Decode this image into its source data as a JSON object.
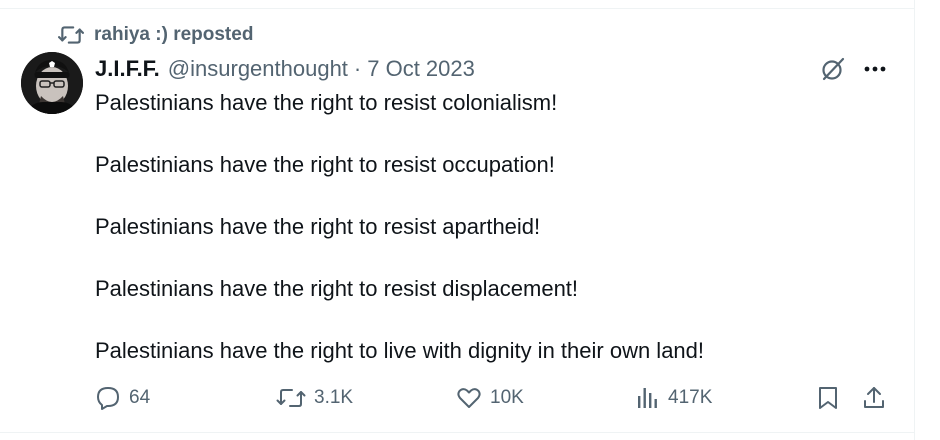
{
  "repost": {
    "label": "rahiya :) reposted",
    "icon": "repost-icon"
  },
  "post": {
    "author_name": "J.I.F.F.",
    "handle": "@insurgenthought",
    "separator": "·",
    "date": "7 Oct 2023",
    "paragraphs": [
      "Palestinians have the right to resist colonialism!",
      "Palestinians have the right to resist occupation!",
      "Palestinians have the right to resist apartheid!",
      "Palestinians have the right to resist displacement!",
      "Palestinians have the right to live with dignity in their own land!"
    ]
  },
  "actions": {
    "replies": "64",
    "reposts": "3.1K",
    "likes": "10K",
    "views": "417K"
  },
  "icons": {
    "grok": "grok-icon",
    "more": "more-options-icon",
    "reply": "reply-icon",
    "repost": "repost-icon",
    "like": "heart-icon",
    "views": "views-icon",
    "bookmark": "bookmark-icon",
    "share": "share-icon"
  },
  "colors": {
    "text": "#0f1419",
    "secondary": "#536471",
    "border": "#eff3f4"
  }
}
